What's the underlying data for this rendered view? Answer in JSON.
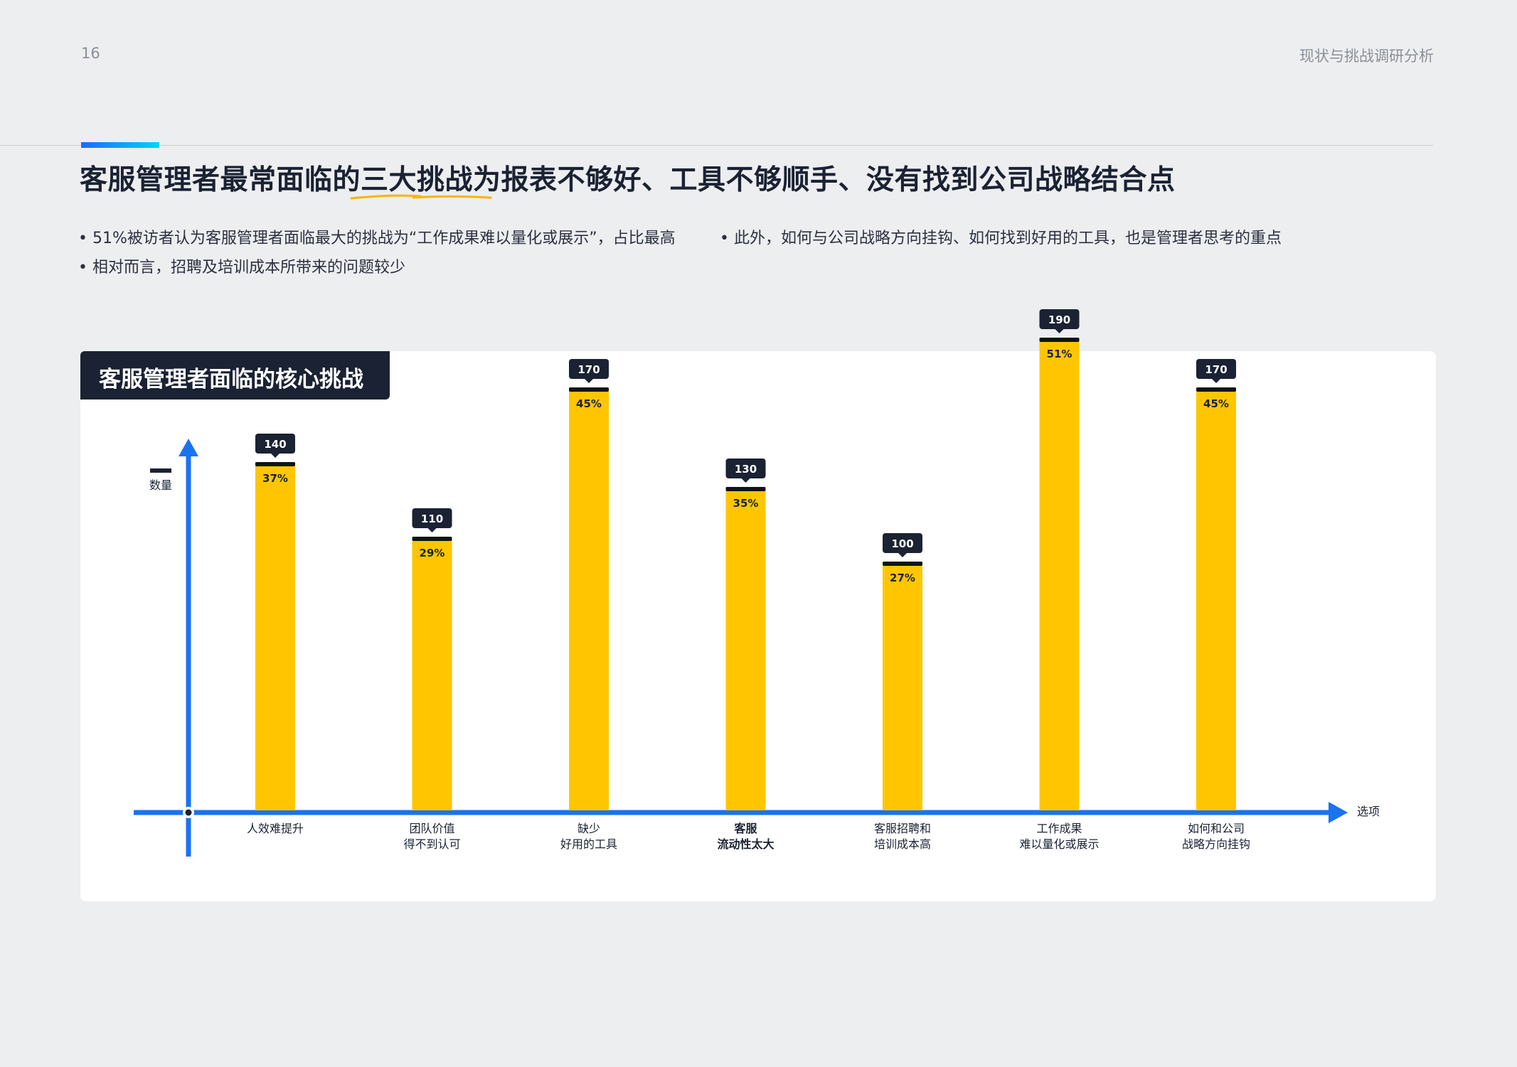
{
  "page": {
    "number": "16",
    "section": "现状与挑战调研分析",
    "headline": "客服管理者最常面临的三大挑战为报表不够好、工具不够顺手、没有找到公司战略结合点",
    "bullets": [
      "51%被访者认为客服管理者面临最大的挑战为“工作成果难以量化或展示”，占比最高",
      "此外，如何与公司战略方向挂钩、如何找到好用的工具，也是管理者思考的重点",
      "相对而言，招聘及培训成本所带来的问题较少"
    ]
  },
  "colors": {
    "bar": "#ffc600",
    "bar_cap": "#101418",
    "axis": "#1a73f0",
    "label_box": "#1a2233",
    "accent_underline": "#f7b500"
  },
  "chart_data": {
    "type": "bar",
    "title": "客服管理者面临的核心挑战",
    "ylabel": "数量",
    "xlabel": "选项",
    "ylim": [
      0,
      210
    ],
    "categories": [
      [
        "人效难提升"
      ],
      [
        "团队价值",
        "得不到认可"
      ],
      [
        "缺少",
        "好用的工具"
      ],
      [
        "客服",
        "流动性太大"
      ],
      [
        "客服招聘和",
        "培训成本高"
      ],
      [
        "工作成果",
        "难以量化或展示"
      ],
      [
        "如何和公司",
        "战略方向挂钩"
      ]
    ],
    "values": [
      140,
      110,
      170,
      130,
      100,
      190,
      170
    ],
    "percent_labels": [
      "37%",
      "29%",
      "45%",
      "35%",
      "27%",
      "51%",
      "45%"
    ],
    "bold_category_index": 3,
    "grid": false,
    "legend": "none"
  }
}
